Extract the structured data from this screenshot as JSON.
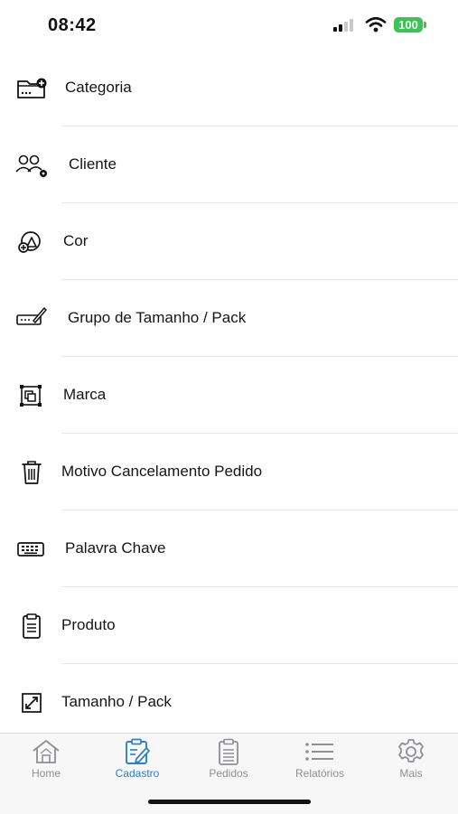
{
  "status": {
    "time": "08:42",
    "battery": "100"
  },
  "menu": {
    "items": [
      {
        "label": "Categoria",
        "icon": "folder-add-icon"
      },
      {
        "label": "Cliente",
        "icon": "users-gear-icon"
      },
      {
        "label": "Cor",
        "icon": "color-palette-icon"
      },
      {
        "label": "Grupo de Tamanho / Pack",
        "icon": "ruler-pencil-icon"
      },
      {
        "label": "Marca",
        "icon": "brand-frame-icon"
      },
      {
        "label": "Motivo Cancelamento Pedido",
        "icon": "trash-icon"
      },
      {
        "label": "Palavra Chave",
        "icon": "keyboard-icon"
      },
      {
        "label": "Produto",
        "icon": "clipboard-icon"
      },
      {
        "label": "Tamanho / Pack",
        "icon": "resize-icon"
      }
    ]
  },
  "tabs": [
    {
      "label": "Home",
      "icon": "home-icon"
    },
    {
      "label": "Cadastro",
      "icon": "edit-form-icon",
      "active": true
    },
    {
      "label": "Pedidos",
      "icon": "orders-clipboard-icon"
    },
    {
      "label": "Relatórios",
      "icon": "list-icon"
    },
    {
      "label": "Mais",
      "icon": "gear-icon"
    }
  ],
  "colors": {
    "accent": "#2a7fd0",
    "inactive": "#8e8e93",
    "battery": "#3bc356"
  }
}
